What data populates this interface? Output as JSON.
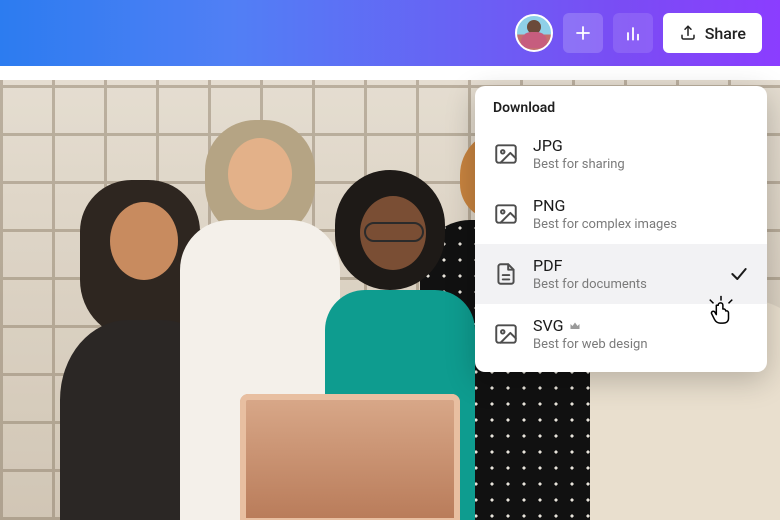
{
  "topbar": {
    "share_label": "Share"
  },
  "panel": {
    "title": "Download",
    "options": [
      {
        "format": "JPG",
        "subtitle": "Best for sharing",
        "kind": "image",
        "premium": false,
        "selected": false
      },
      {
        "format": "PNG",
        "subtitle": "Best for complex images",
        "kind": "image",
        "premium": false,
        "selected": false
      },
      {
        "format": "PDF",
        "subtitle": "Best for documents",
        "kind": "doc",
        "premium": false,
        "selected": true
      },
      {
        "format": "SVG",
        "subtitle": "Best for web design",
        "kind": "image",
        "premium": true,
        "selected": false
      }
    ]
  }
}
